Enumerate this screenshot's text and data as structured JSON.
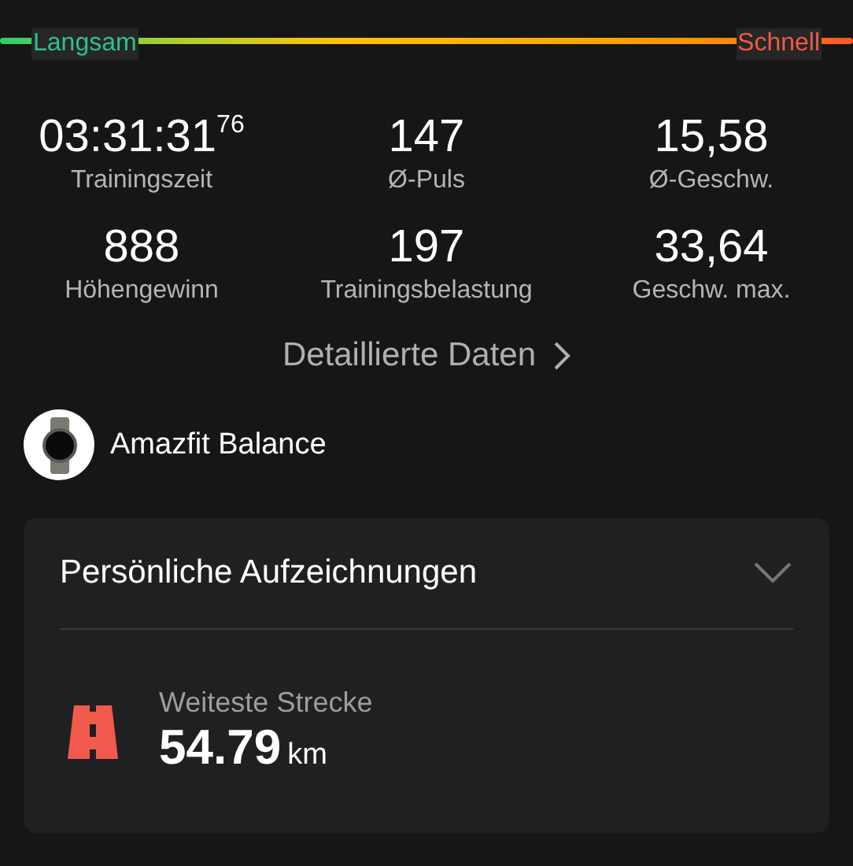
{
  "speed_legend": {
    "slow": "Langsam",
    "fast": "Schnell"
  },
  "stats": [
    {
      "value": "03:31:31$^{76}$",
      "label": "Trainingszeit"
    },
    {
      "value": "147",
      "label": "Ø-Puls"
    },
    {
      "value": "15,58",
      "label": "Ø-Geschw."
    },
    {
      "value": "888",
      "label": "Höhengewinn"
    },
    {
      "value": "197",
      "label": "Trainingsbelastung"
    },
    {
      "value": "33,64",
      "label": "Geschw. max."
    }
  ],
  "details_link": "Detaillierte Daten",
  "device": {
    "name": "Amazfit Balance"
  },
  "records": {
    "title": "Persönliche Aufzeichnungen",
    "expanded": false,
    "items": [
      {
        "label": "Weiteste Strecke",
        "value": "54.79",
        "unit": "km"
      }
    ]
  }
}
